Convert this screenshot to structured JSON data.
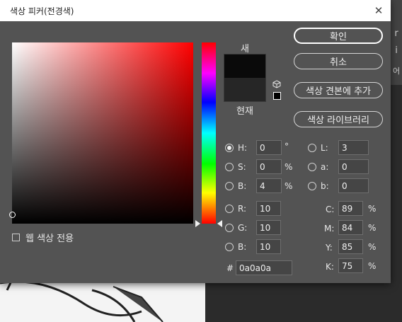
{
  "window": {
    "title": "색상 피커(전경색)"
  },
  "background": {
    "right_marks": [
      "r",
      "i",
      "어"
    ]
  },
  "color_field": {
    "web_only_label": "웹 색상 전용"
  },
  "swatch": {
    "new_label": "새",
    "current_label": "현재",
    "new_color": "#0a0a0a",
    "current_color": "#262626"
  },
  "buttons": {
    "ok": "확인",
    "cancel": "취소",
    "add_swatch": "색상 견본에 추가",
    "libraries": "색상 라이브러리"
  },
  "hsb": {
    "h": {
      "label": "H:",
      "value": "0",
      "unit": "°",
      "selected": true
    },
    "s": {
      "label": "S:",
      "value": "0",
      "unit": "%",
      "selected": false
    },
    "b": {
      "label": "B:",
      "value": "4",
      "unit": "%",
      "selected": false
    }
  },
  "lab": {
    "l": {
      "label": "L:",
      "value": "3"
    },
    "a": {
      "label": "a:",
      "value": "0"
    },
    "b": {
      "label": "b:",
      "value": "0"
    }
  },
  "rgb": {
    "r": {
      "label": "R:",
      "value": "10"
    },
    "g": {
      "label": "G:",
      "value": "10"
    },
    "b": {
      "label": "B:",
      "value": "10"
    }
  },
  "cmyk": {
    "c": {
      "label": "C:",
      "value": "89",
      "unit": "%"
    },
    "m": {
      "label": "M:",
      "value": "84",
      "unit": "%"
    },
    "y": {
      "label": "Y:",
      "value": "85",
      "unit": "%"
    },
    "k": {
      "label": "K:",
      "value": "75",
      "unit": "%"
    }
  },
  "hex": {
    "label": "#",
    "value": "0a0a0a"
  }
}
